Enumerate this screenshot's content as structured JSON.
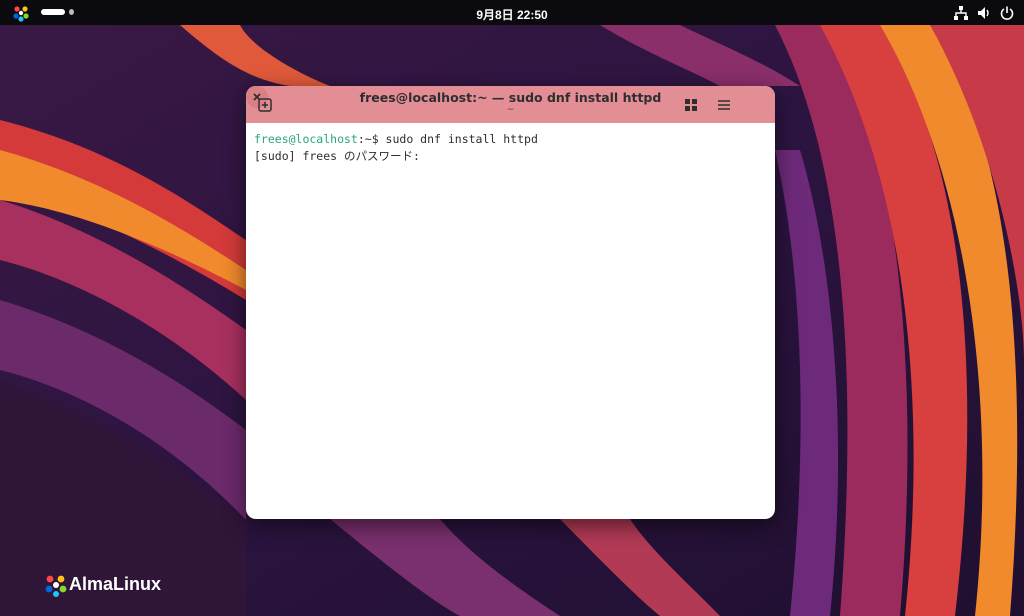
{
  "topbar": {
    "clock": "9月8日  22:50",
    "icons": [
      "almalinux-logo-icon",
      "network-icon",
      "volume-icon",
      "power-icon"
    ]
  },
  "terminal": {
    "title": "frees@localhost:~ — sudo dnf install httpd",
    "subtitle": "~",
    "lines": {
      "l1_prompt": "frees@localhost",
      "l1_rest": ":~$ sudo dnf install httpd",
      "l2": "[sudo] frees のパスワード:"
    },
    "headerbar_color": "#e38d95"
  },
  "desktop": {
    "brand": "AlmaLinux"
  }
}
